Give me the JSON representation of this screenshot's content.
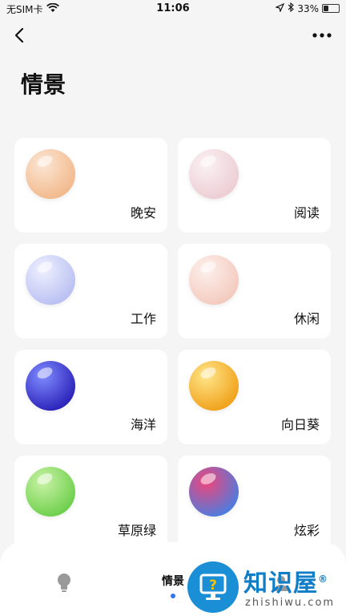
{
  "status_bar": {
    "carrier": "无SIM卡",
    "time": "11:06",
    "battery_percent": "33%",
    "battery_level": 0.33,
    "icons": [
      "wifi-icon",
      "location-icon",
      "bluetooth-icon",
      "battery-icon"
    ]
  },
  "nav": {
    "back_icon": "chevron-left-icon",
    "more_icon": "more-dots-icon"
  },
  "page": {
    "title": "情景"
  },
  "scenes": [
    {
      "label": "晚安",
      "orb_colors": [
        "#fbe6d4",
        "#f2b88a"
      ]
    },
    {
      "label": "阅读",
      "orb_colors": [
        "#fbf1f3",
        "#eccdd3"
      ]
    },
    {
      "label": "工作",
      "orb_colors": [
        "#eef0ff",
        "#b8bff1"
      ]
    },
    {
      "label": "休闲",
      "orb_colors": [
        "#fdf0ec",
        "#f3c9bd"
      ]
    },
    {
      "label": "海洋",
      "orb_colors": [
        "#7f8cff",
        "#2a20b8"
      ]
    },
    {
      "label": "向日葵",
      "orb_colors": [
        "#ffe68a",
        "#f0a018"
      ]
    },
    {
      "label": "草原绿",
      "orb_colors": [
        "#c9f2a6",
        "#6ccf4a"
      ]
    },
    {
      "label": "炫彩",
      "orb_colors": [
        "#f0457a",
        "#4a7de0"
      ]
    }
  ],
  "tab_bar": {
    "active_label": "情景",
    "accent": "#2f74f0",
    "icons": [
      "bulb-icon",
      "scene-tab",
      "user-icon"
    ]
  },
  "watermark": {
    "title": "知识屋",
    "registered": "®",
    "url": "zhishiwu.com"
  }
}
